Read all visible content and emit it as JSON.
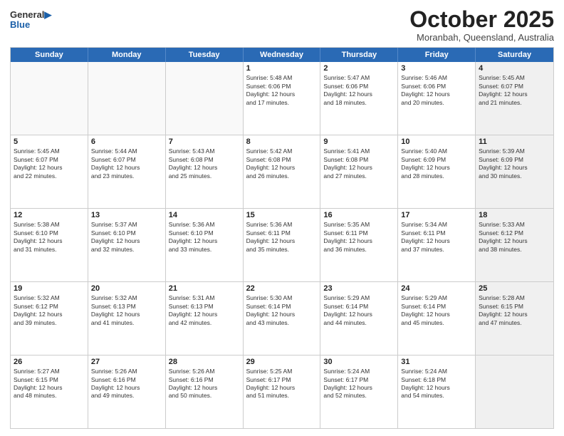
{
  "header": {
    "logo_line1": "General",
    "logo_line2": "Blue",
    "month_title": "October 2025",
    "location": "Moranbah, Queensland, Australia"
  },
  "day_headers": [
    "Sunday",
    "Monday",
    "Tuesday",
    "Wednesday",
    "Thursday",
    "Friday",
    "Saturday"
  ],
  "weeks": [
    [
      {
        "num": "",
        "info": "",
        "empty": true
      },
      {
        "num": "",
        "info": "",
        "empty": true
      },
      {
        "num": "",
        "info": "",
        "empty": true
      },
      {
        "num": "1",
        "info": "Sunrise: 5:48 AM\nSunset: 6:06 PM\nDaylight: 12 hours\nand 17 minutes."
      },
      {
        "num": "2",
        "info": "Sunrise: 5:47 AM\nSunset: 6:06 PM\nDaylight: 12 hours\nand 18 minutes."
      },
      {
        "num": "3",
        "info": "Sunrise: 5:46 AM\nSunset: 6:06 PM\nDaylight: 12 hours\nand 20 minutes."
      },
      {
        "num": "4",
        "info": "Sunrise: 5:45 AM\nSunset: 6:07 PM\nDaylight: 12 hours\nand 21 minutes.",
        "shaded": true
      }
    ],
    [
      {
        "num": "5",
        "info": "Sunrise: 5:45 AM\nSunset: 6:07 PM\nDaylight: 12 hours\nand 22 minutes."
      },
      {
        "num": "6",
        "info": "Sunrise: 5:44 AM\nSunset: 6:07 PM\nDaylight: 12 hours\nand 23 minutes."
      },
      {
        "num": "7",
        "info": "Sunrise: 5:43 AM\nSunset: 6:08 PM\nDaylight: 12 hours\nand 25 minutes."
      },
      {
        "num": "8",
        "info": "Sunrise: 5:42 AM\nSunset: 6:08 PM\nDaylight: 12 hours\nand 26 minutes."
      },
      {
        "num": "9",
        "info": "Sunrise: 5:41 AM\nSunset: 6:08 PM\nDaylight: 12 hours\nand 27 minutes."
      },
      {
        "num": "10",
        "info": "Sunrise: 5:40 AM\nSunset: 6:09 PM\nDaylight: 12 hours\nand 28 minutes."
      },
      {
        "num": "11",
        "info": "Sunrise: 5:39 AM\nSunset: 6:09 PM\nDaylight: 12 hours\nand 30 minutes.",
        "shaded": true
      }
    ],
    [
      {
        "num": "12",
        "info": "Sunrise: 5:38 AM\nSunset: 6:10 PM\nDaylight: 12 hours\nand 31 minutes."
      },
      {
        "num": "13",
        "info": "Sunrise: 5:37 AM\nSunset: 6:10 PM\nDaylight: 12 hours\nand 32 minutes."
      },
      {
        "num": "14",
        "info": "Sunrise: 5:36 AM\nSunset: 6:10 PM\nDaylight: 12 hours\nand 33 minutes."
      },
      {
        "num": "15",
        "info": "Sunrise: 5:36 AM\nSunset: 6:11 PM\nDaylight: 12 hours\nand 35 minutes."
      },
      {
        "num": "16",
        "info": "Sunrise: 5:35 AM\nSunset: 6:11 PM\nDaylight: 12 hours\nand 36 minutes."
      },
      {
        "num": "17",
        "info": "Sunrise: 5:34 AM\nSunset: 6:11 PM\nDaylight: 12 hours\nand 37 minutes."
      },
      {
        "num": "18",
        "info": "Sunrise: 5:33 AM\nSunset: 6:12 PM\nDaylight: 12 hours\nand 38 minutes.",
        "shaded": true
      }
    ],
    [
      {
        "num": "19",
        "info": "Sunrise: 5:32 AM\nSunset: 6:12 PM\nDaylight: 12 hours\nand 39 minutes."
      },
      {
        "num": "20",
        "info": "Sunrise: 5:32 AM\nSunset: 6:13 PM\nDaylight: 12 hours\nand 41 minutes."
      },
      {
        "num": "21",
        "info": "Sunrise: 5:31 AM\nSunset: 6:13 PM\nDaylight: 12 hours\nand 42 minutes."
      },
      {
        "num": "22",
        "info": "Sunrise: 5:30 AM\nSunset: 6:14 PM\nDaylight: 12 hours\nand 43 minutes."
      },
      {
        "num": "23",
        "info": "Sunrise: 5:29 AM\nSunset: 6:14 PM\nDaylight: 12 hours\nand 44 minutes."
      },
      {
        "num": "24",
        "info": "Sunrise: 5:29 AM\nSunset: 6:14 PM\nDaylight: 12 hours\nand 45 minutes."
      },
      {
        "num": "25",
        "info": "Sunrise: 5:28 AM\nSunset: 6:15 PM\nDaylight: 12 hours\nand 47 minutes.",
        "shaded": true
      }
    ],
    [
      {
        "num": "26",
        "info": "Sunrise: 5:27 AM\nSunset: 6:15 PM\nDaylight: 12 hours\nand 48 minutes."
      },
      {
        "num": "27",
        "info": "Sunrise: 5:26 AM\nSunset: 6:16 PM\nDaylight: 12 hours\nand 49 minutes."
      },
      {
        "num": "28",
        "info": "Sunrise: 5:26 AM\nSunset: 6:16 PM\nDaylight: 12 hours\nand 50 minutes."
      },
      {
        "num": "29",
        "info": "Sunrise: 5:25 AM\nSunset: 6:17 PM\nDaylight: 12 hours\nand 51 minutes."
      },
      {
        "num": "30",
        "info": "Sunrise: 5:24 AM\nSunset: 6:17 PM\nDaylight: 12 hours\nand 52 minutes."
      },
      {
        "num": "31",
        "info": "Sunrise: 5:24 AM\nSunset: 6:18 PM\nDaylight: 12 hours\nand 54 minutes."
      },
      {
        "num": "",
        "info": "",
        "empty": true,
        "shaded": true
      }
    ]
  ]
}
